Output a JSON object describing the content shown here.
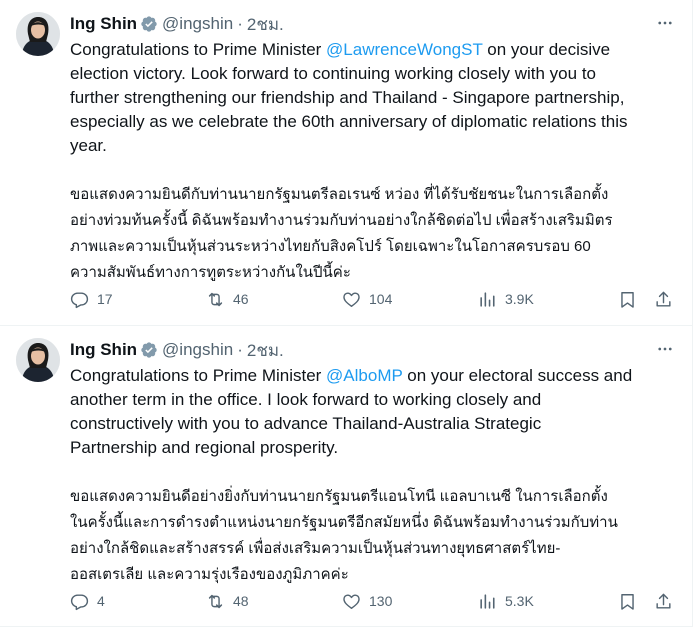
{
  "colors": {
    "accent": "#1d9bf0",
    "text": "#0f1419",
    "muted": "#536471",
    "divider": "#eff3f4"
  },
  "tweets": [
    {
      "name": "Ing Shin",
      "handle": "@ingshin",
      "separator": "·",
      "time": "2ชม.",
      "text_before": "Congratulations to Prime Minister ",
      "mention": "@LawrenceWongST",
      "text_after": " on your decisive\nelection victory. Look forward to continuing working closely with you to\nfurther strengthening our friendship and Thailand - Singapore partnership,\nespecially as we celebrate the 60th anniversary of diplomatic relations this\nyear.",
      "text_thai": "ขอแสดงความยินดีกับท่านนายกรัฐมนตรีลอเรนซ์ หว่อง ที่ได้รับชัยชนะในการเลือกตั้ง\nอย่างท่วมท้นครั้งนี้ ดิฉันพร้อมทำงานร่วมกับท่านอย่างใกล้ชิดต่อไป เพื่อสร้างเสริมมิตร\nภาพและความเป็นหุ้นส่วนระหว่างไทยกับสิงคโปร์ โดยเฉพาะในโอกาสครบรอบ 60\nความสัมพันธ์ทางการทูตระหว่างกันในปีนี้ค่ะ",
      "replies": "17",
      "reposts": "46",
      "likes": "104",
      "views": "3.9K",
      "icons": [
        "reply-icon",
        "repost-icon",
        "like-icon",
        "views-icon",
        "bookmark-icon",
        "share-icon"
      ]
    },
    {
      "name": "Ing Shin",
      "handle": "@ingshin",
      "separator": "·",
      "time": "2ชม.",
      "text_before": "Congratulations to Prime Minister ",
      "mention": "@AlboMP",
      "text_after": " on your electoral success and\nanother term in the office. I look forward to working closely and\nconstructively with you to advance Thailand-Australia Strategic\nPartnership and regional prosperity.",
      "text_thai": "ขอแสดงความยินดีอย่างยิ่งกับท่านนายกรัฐมนตรีแอนโทนี แอลบาเนซี ในการเลือกตั้ง\nในครั้งนี้และการดำรงตำแหน่งนายกรัฐมนตรีอีกสมัยหนึ่ง ดิฉันพร้อมทำงานร่วมกับท่าน\nอย่างใกล้ชิดและสร้างสรรค์ เพื่อส่งเสริมความเป็นหุ้นส่วนทางยุทธศาสตร์ไทย-\nออสเตรเลีย และความรุ่งเรืองของภูมิภาคค่ะ",
      "replies": "4",
      "reposts": "48",
      "likes": "130",
      "views": "5.3K",
      "icons": [
        "reply-icon",
        "repost-icon",
        "like-icon",
        "views-icon",
        "bookmark-icon",
        "share-icon"
      ]
    }
  ]
}
